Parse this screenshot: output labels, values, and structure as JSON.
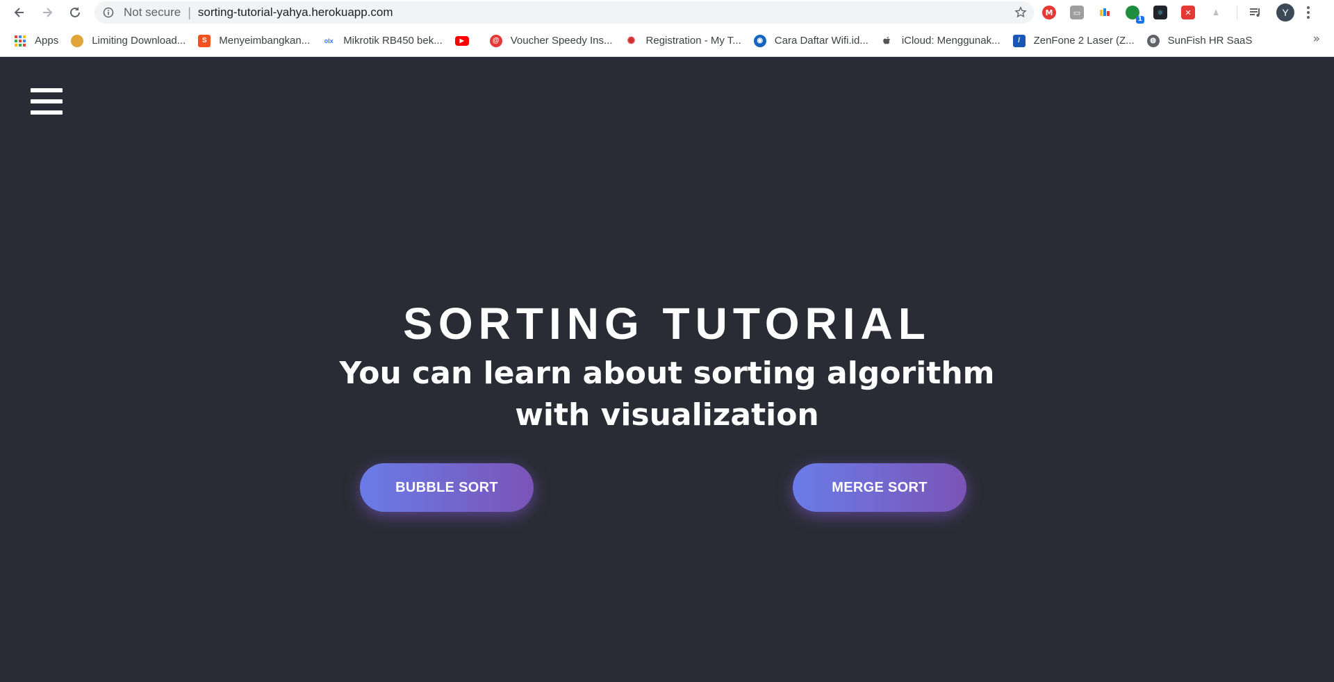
{
  "browser": {
    "not_secure_label": "Not secure",
    "separator": "|",
    "url": "sorting-tutorial-yahya.herokuapp.com",
    "avatar_initial": "Y",
    "extension_badge": "1"
  },
  "bookmarks": {
    "items": [
      {
        "label": "Apps",
        "icon": "apps-grid-icon",
        "color": "#e8453c"
      },
      {
        "label": "Limiting Download...",
        "icon": "circle-logo-icon",
        "color": "#e0a43a"
      },
      {
        "label": "Menyeimbangkan...",
        "icon": "s-logo-icon",
        "color": "#f4511e"
      },
      {
        "label": "Mikrotik RB450 bek...",
        "icon": "olx-logo-icon",
        "color": "#3a77ff"
      },
      {
        "label": "",
        "icon": "youtube-icon",
        "color": "#ff0000"
      },
      {
        "label": "Voucher Speedy Ins...",
        "icon": "at-logo-icon",
        "color": "#e53935"
      },
      {
        "label": "Registration - My T...",
        "icon": "flame-logo-icon",
        "color": "#d32f2f"
      },
      {
        "label": "Cara Daftar Wifi.id...",
        "icon": "globe-logo-icon",
        "color": "#1565c0"
      },
      {
        "label": "iCloud: Menggunak...",
        "icon": "apple-icon",
        "color": "#555555"
      },
      {
        "label": "ZenFone 2 Laser (Z...",
        "icon": "asus-logo-icon",
        "color": "#1a56b6"
      },
      {
        "label": "SunFish HR SaaS",
        "icon": "world-icon",
        "color": "#5f6368"
      }
    ],
    "more": "»"
  },
  "page": {
    "title": "SORTING TUTORIAL",
    "subtitle": "You can learn about sorting algorithm with visualization",
    "buttons": {
      "bubble": "BUBBLE SORT",
      "merge": "MERGE SORT"
    }
  },
  "colors": {
    "page_background": "#2a2c35",
    "button_gradient_start": "#6a7ce8",
    "button_gradient_end": "#7a54b6",
    "text": "#ffffff"
  }
}
